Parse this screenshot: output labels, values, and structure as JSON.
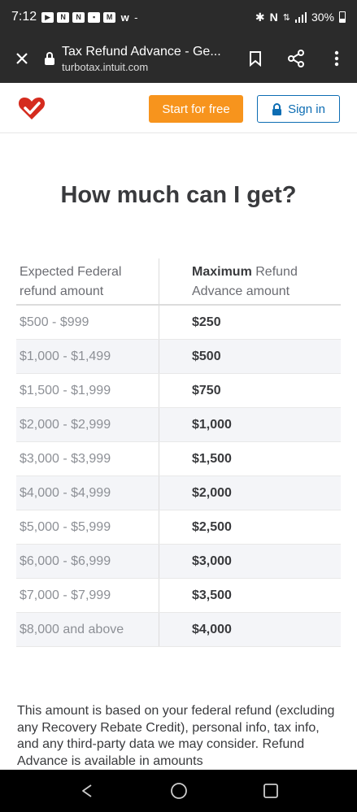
{
  "status_bar": {
    "time": "7:12",
    "battery": "30%"
  },
  "browser": {
    "page_title": "Tax Refund Advance - Ge...",
    "url": "turbotax.intuit.com"
  },
  "site_header": {
    "start_label": "Start for free",
    "signin_label": "Sign in",
    "colors": {
      "accent": "#f7941d",
      "link": "#0d6db3",
      "brand": "#d52b1e"
    }
  },
  "heading": "How much can I get?",
  "table": {
    "header_left": "Expected Federal refund amount",
    "header_right_bold": "Maximum",
    "header_right_rest": " Refund Advance amount",
    "rows": [
      {
        "range": "$500 - $999",
        "max": "$250"
      },
      {
        "range": "$1,000 - $1,499",
        "max": "$500"
      },
      {
        "range": "$1,500 - $1,999",
        "max": "$750"
      },
      {
        "range": "$2,000 - $2,999",
        "max": "$1,000"
      },
      {
        "range": "$3,000 - $3,999",
        "max": "$1,500"
      },
      {
        "range": "$4,000 - $4,999",
        "max": "$2,000"
      },
      {
        "range": "$5,000 - $5,999",
        "max": "$2,500"
      },
      {
        "range": "$6,000 - $6,999",
        "max": "$3,000"
      },
      {
        "range": "$7,000 - $7,999",
        "max": "$3,500"
      },
      {
        "range": "$8,000 and above",
        "max": "$4,000"
      }
    ]
  },
  "paragraph": "This amount is based on your federal refund (excluding any Recovery Rebate Credit), personal info, tax info, and any third-party data we may consider. Refund Advance is available in amounts"
}
